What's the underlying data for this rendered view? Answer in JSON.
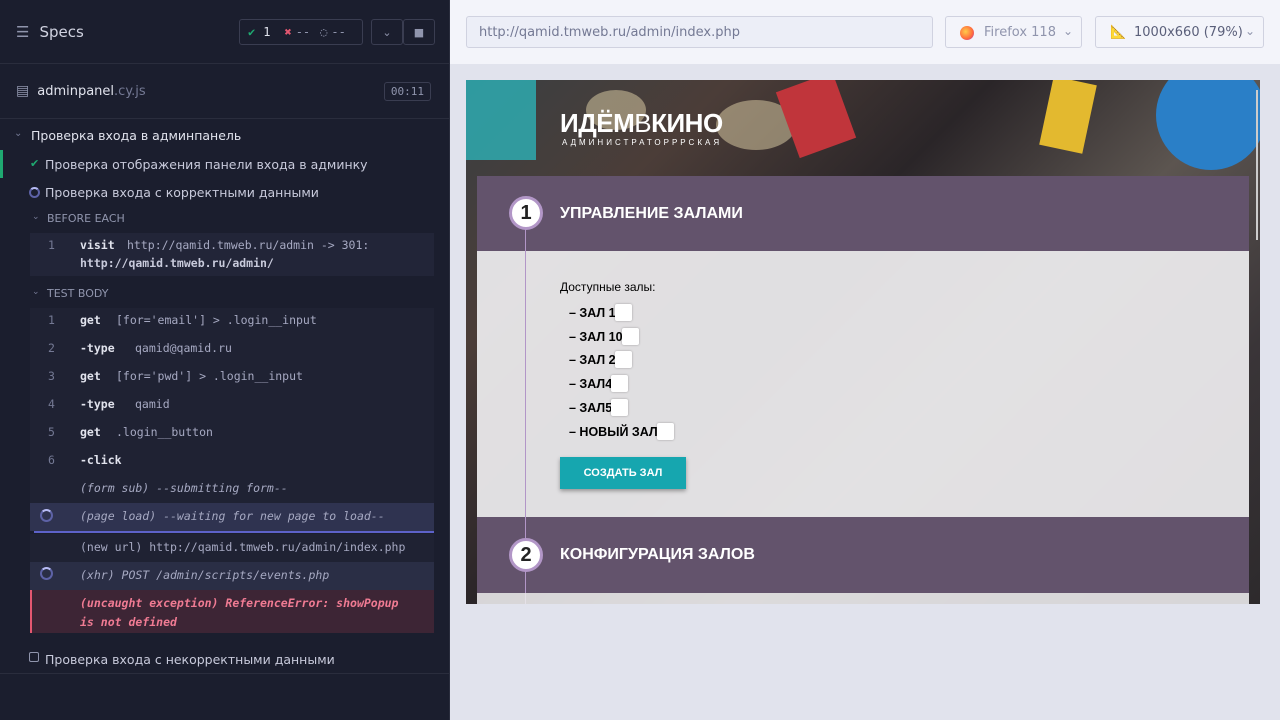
{
  "reporter": {
    "title": "Specs",
    "stats": {
      "passed": "1",
      "failed": "--",
      "pending": "--"
    },
    "file": {
      "name": "adminpanel",
      "ext": ".cy.js",
      "duration": "00:11"
    },
    "suite": "Проверка входа в админпанель",
    "tests": [
      "Проверка отображения панели входа в админку",
      "Проверка входа с корректными данными",
      "Проверка входа с некорректными данными"
    ],
    "hooks": {
      "before_each": "BEFORE EACH",
      "test_body": "TEST BODY"
    },
    "before_each_cmd": {
      "num": "1",
      "name": "visit",
      "msg": "http://qamid.tmweb.ru/admin -> 301:",
      "msg2": "http://qamid.tmweb.ru/admin/"
    },
    "commands": [
      {
        "num": "1",
        "name": "get",
        "msg": "[for='email'] > .login__input"
      },
      {
        "num": "2",
        "name": "-type",
        "msg": "qamid@qamid.ru"
      },
      {
        "num": "3",
        "name": "get",
        "msg": "[for='pwd'] > .login__input"
      },
      {
        "num": "4",
        "name": "-type",
        "msg": "qamid"
      },
      {
        "num": "5",
        "name": "get",
        "msg": ".login__button"
      },
      {
        "num": "6",
        "name": "-click",
        "msg": ""
      }
    ],
    "events": {
      "form_sub": "(form sub)  --submitting form--",
      "page_load": "(page load)  --waiting for new page to load--",
      "new_url": "(new url)  http://qamid.tmweb.ru/admin/index.php",
      "xhr": "(xhr)     POST /admin/scripts/events.php"
    },
    "error": {
      "line1": "(uncaught exception)  ReferenceError: showPopup",
      "line2": "is not defined"
    }
  },
  "aut": {
    "url": "http://qamid.tmweb.ru/admin/index.php",
    "browser": "Firefox 118",
    "viewport": "1000x660  (79%)"
  },
  "site": {
    "logo_a": "ИДЁМ",
    "logo_b": "В",
    "logo_c": "КИНО",
    "logo_sub": "АДМИНИСТРАТОРРРСКАЯ",
    "section1": {
      "num": "1",
      "title": "УПРАВЛЕНИЕ ЗАЛАМИ"
    },
    "halls_label": "Доступные залы:",
    "halls": [
      "– ЗАЛ 1",
      "– ЗАЛ 10",
      "– ЗАЛ 2",
      "– ЗАЛ4",
      "– ЗАЛ5",
      "– НОВЫЙ ЗАЛ"
    ],
    "create_button": "СОЗДАТЬ ЗАЛ",
    "section2": {
      "num": "2",
      "title": "КОНФИГУРАЦИЯ ЗАЛОВ"
    }
  },
  "colors": {
    "pass": "#1fa971",
    "fail": "#e45770",
    "accent": "#16a6af",
    "section": "#63536c"
  }
}
